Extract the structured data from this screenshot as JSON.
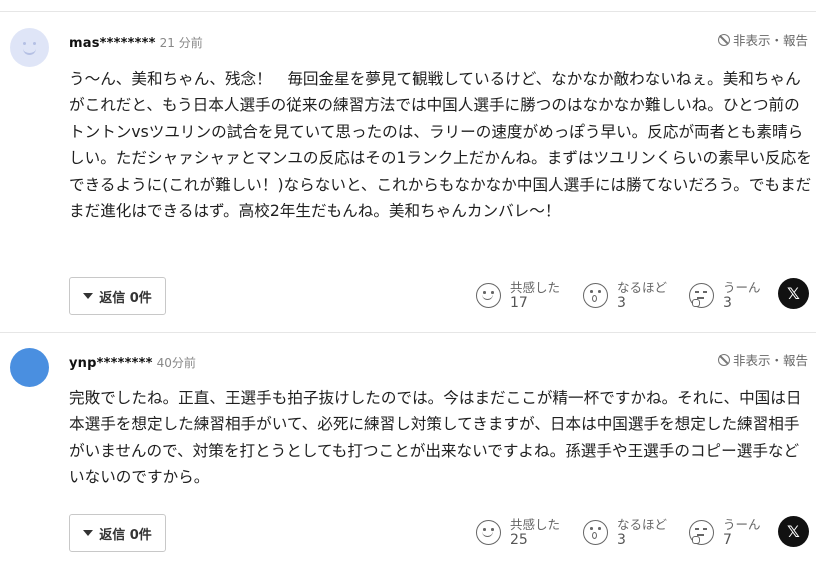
{
  "comments": [
    {
      "username": "mas********",
      "time": "21 分前",
      "report_label": "非表示・報告",
      "text": "う〜ん、美和ちゃん、残念！　毎回金星を夢見て観戦しているけど、なかなか敵わないねぇ。美和ちゃんがこれだと、もう日本人選手の従来の練習方法では中国人選手に勝つのはなかなか難しいね。ひとつ前のトントンvsツユリンの試合を見ていて思ったのは、ラリーの速度がめっぽう早い。反応が両者とも素晴らしい。ただシャァシャァとマンユの反応はその1ランク上だかんね。まずはツユリンくらいの素早い反応をできるように(これが難しい！)ならないと、これからもなかなか中国人選手には勝てないだろう。でもまだまだ進化はできるはず。高校2年生だもんね。美和ちゃんカンバレ〜！",
      "reply_label": "返信 0件",
      "reactions": [
        {
          "label": "共感した",
          "count": "17",
          "icon": "smile-icon"
        },
        {
          "label": "なるほど",
          "count": "3",
          "icon": "surprised-icon"
        },
        {
          "label": "うーん",
          "count": "3",
          "icon": "thinking-icon"
        }
      ],
      "share_label": "𝕏"
    },
    {
      "username": "ynp********",
      "time": "40分前",
      "report_label": "非表示・報告",
      "text": "完敗でしたね。正直、王選手も拍子抜けしたのでは。今はまだここが精一杯ですかね。それに、中国は日本選手を想定した練習相手がいて、必死に練習し対策してきますが、日本は中国選手を想定した練習相手がいませんので、対策を打とうとしても打つことが出来ないですよね。孫選手や王選手のコピー選手などいないのですから。",
      "reply_label": "返信 0件",
      "reactions": [
        {
          "label": "共感した",
          "count": "25",
          "icon": "smile-icon"
        },
        {
          "label": "なるほど",
          "count": "3",
          "icon": "surprised-icon"
        },
        {
          "label": "うーん",
          "count": "7",
          "icon": "thinking-icon"
        }
      ],
      "share_label": "𝕏"
    }
  ]
}
